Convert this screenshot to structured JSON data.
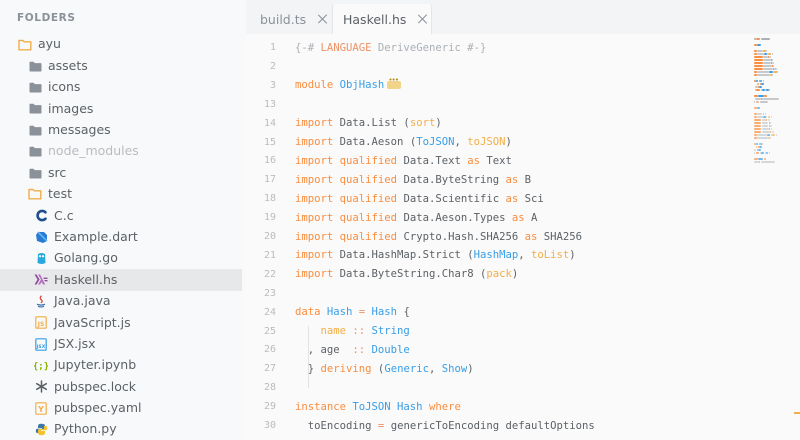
{
  "sidebar": {
    "header": "FOLDERS",
    "items": [
      {
        "label": "ayu",
        "icon": "folder-open-icon",
        "depth": 0
      },
      {
        "label": "assets",
        "icon": "folder-icon",
        "depth": 1
      },
      {
        "label": "icons",
        "icon": "folder-icon",
        "depth": 1
      },
      {
        "label": "images",
        "icon": "folder-icon",
        "depth": 1
      },
      {
        "label": "messages",
        "icon": "folder-icon",
        "depth": 1
      },
      {
        "label": "node_modules",
        "icon": "folder-icon",
        "depth": 1,
        "dim": true
      },
      {
        "label": "src",
        "icon": "folder-icon",
        "depth": 1
      },
      {
        "label": "test",
        "icon": "folder-open-icon",
        "depth": 1
      },
      {
        "label": "C.c",
        "icon": "c-file-icon",
        "depth": 2
      },
      {
        "label": "Example.dart",
        "icon": "dart-file-icon",
        "depth": 2
      },
      {
        "label": "Golang.go",
        "icon": "go-file-icon",
        "depth": 2
      },
      {
        "label": "Haskell.hs",
        "icon": "haskell-file-icon",
        "depth": 2,
        "selected": true
      },
      {
        "label": "Java.java",
        "icon": "java-file-icon",
        "depth": 2
      },
      {
        "label": "JavaScript.js",
        "icon": "javascript-file-icon",
        "depth": 2
      },
      {
        "label": "JSX.jsx",
        "icon": "jsx-file-icon",
        "depth": 2
      },
      {
        "label": "Jupyter.ipynb",
        "icon": "jupyter-file-icon",
        "depth": 2
      },
      {
        "label": "pubspec.lock",
        "icon": "lock-file-icon",
        "depth": 2
      },
      {
        "label": "pubspec.yaml",
        "icon": "yaml-file-icon",
        "depth": 2
      },
      {
        "label": "Python.py",
        "icon": "python-file-icon",
        "depth": 2
      }
    ]
  },
  "tabs": [
    {
      "label": "build.ts",
      "active": false
    },
    {
      "label": "Haskell.hs",
      "active": true
    }
  ],
  "editor": {
    "lines": [
      {
        "n": "1",
        "tokens": [
          [
            "cm",
            "{-# "
          ],
          [
            "op",
            "LANGUAGE"
          ],
          [
            "cm",
            " DeriveGeneric #-}"
          ]
        ]
      },
      {
        "n": "2",
        "tokens": []
      },
      {
        "n": "3",
        "tokens": [
          [
            "kw",
            "module "
          ],
          [
            "ty",
            "ObjHash"
          ]
        ],
        "fold": true
      },
      {
        "n": "13",
        "tokens": []
      },
      {
        "n": "14",
        "tokens": [
          [
            "kw",
            "import "
          ],
          [
            "pr",
            "Data.List ("
          ],
          [
            "fn",
            "sort"
          ],
          [
            "pr",
            ")"
          ]
        ]
      },
      {
        "n": "15",
        "tokens": [
          [
            "kw",
            "import "
          ],
          [
            "pr",
            "Data.Aeson ("
          ],
          [
            "ty",
            "ToJSON"
          ],
          [
            "pr",
            ", "
          ],
          [
            "fn",
            "toJSON"
          ],
          [
            "pr",
            ")"
          ]
        ]
      },
      {
        "n": "16",
        "tokens": [
          [
            "kw",
            "import qualified "
          ],
          [
            "pr",
            "Data.Text "
          ],
          [
            "kw",
            "as "
          ],
          [
            "pr",
            "Text"
          ]
        ]
      },
      {
        "n": "17",
        "tokens": [
          [
            "kw",
            "import qualified "
          ],
          [
            "pr",
            "Data.ByteString "
          ],
          [
            "kw",
            "as "
          ],
          [
            "pr",
            "B"
          ]
        ]
      },
      {
        "n": "18",
        "tokens": [
          [
            "kw",
            "import qualified "
          ],
          [
            "pr",
            "Data.Scientific "
          ],
          [
            "kw",
            "as "
          ],
          [
            "pr",
            "Sci"
          ]
        ]
      },
      {
        "n": "19",
        "tokens": [
          [
            "kw",
            "import qualified "
          ],
          [
            "pr",
            "Data.Aeson.Types "
          ],
          [
            "kw",
            "as "
          ],
          [
            "pr",
            "A"
          ]
        ]
      },
      {
        "n": "20",
        "tokens": [
          [
            "kw",
            "import qualified "
          ],
          [
            "pr",
            "Crypto.Hash.SHA256 "
          ],
          [
            "kw",
            "as "
          ],
          [
            "pr",
            "SHA256"
          ]
        ]
      },
      {
        "n": "21",
        "tokens": [
          [
            "kw",
            "import "
          ],
          [
            "pr",
            "Data.HashMap.Strict ("
          ],
          [
            "ty",
            "HashMap"
          ],
          [
            "pr",
            ", "
          ],
          [
            "fn",
            "toList"
          ],
          [
            "pr",
            ")"
          ]
        ]
      },
      {
        "n": "22",
        "tokens": [
          [
            "kw",
            "import "
          ],
          [
            "pr",
            "Data.ByteString.Char8 ("
          ],
          [
            "fn",
            "pack"
          ],
          [
            "pr",
            ")"
          ]
        ]
      },
      {
        "n": "23",
        "tokens": []
      },
      {
        "n": "24",
        "tokens": [
          [
            "kw",
            "data "
          ],
          [
            "ty",
            "Hash"
          ],
          [
            "op",
            " = "
          ],
          [
            "ty",
            "Hash"
          ],
          [
            "pr",
            " {"
          ]
        ]
      },
      {
        "n": "25",
        "tokens": [
          [
            "pr",
            "    "
          ],
          [
            "fn",
            "name"
          ],
          [
            "op",
            " :: "
          ],
          [
            "ty",
            "String"
          ]
        ]
      },
      {
        "n": "26",
        "tokens": [
          [
            "pr",
            "  , age  "
          ],
          [
            "op",
            ":: "
          ],
          [
            "ty",
            "Double"
          ]
        ]
      },
      {
        "n": "27",
        "tokens": [
          [
            "pr",
            "  } "
          ],
          [
            "kw",
            "deriving "
          ],
          [
            "pr",
            "("
          ],
          [
            "ty",
            "Generic"
          ],
          [
            "pr",
            ", "
          ],
          [
            "ty",
            "Show"
          ],
          [
            "pr",
            ")"
          ]
        ]
      },
      {
        "n": "28",
        "tokens": []
      },
      {
        "n": "29",
        "tokens": [
          [
            "kw",
            "instance "
          ],
          [
            "ty",
            "ToJSON Hash "
          ],
          [
            "kw",
            "where"
          ]
        ]
      },
      {
        "n": "30",
        "tokens": [
          [
            "pr",
            "  toEncoding "
          ],
          [
            "op",
            "= "
          ],
          [
            "pr",
            "genericToEncoding defaultOptions"
          ]
        ]
      }
    ]
  },
  "colors": {
    "keyword": "#fa8d3e",
    "type": "#399ee6",
    "function": "#f2ae49",
    "operator": "#ed9366",
    "comment": "#abb0b6",
    "folder": "#f2ae49"
  }
}
